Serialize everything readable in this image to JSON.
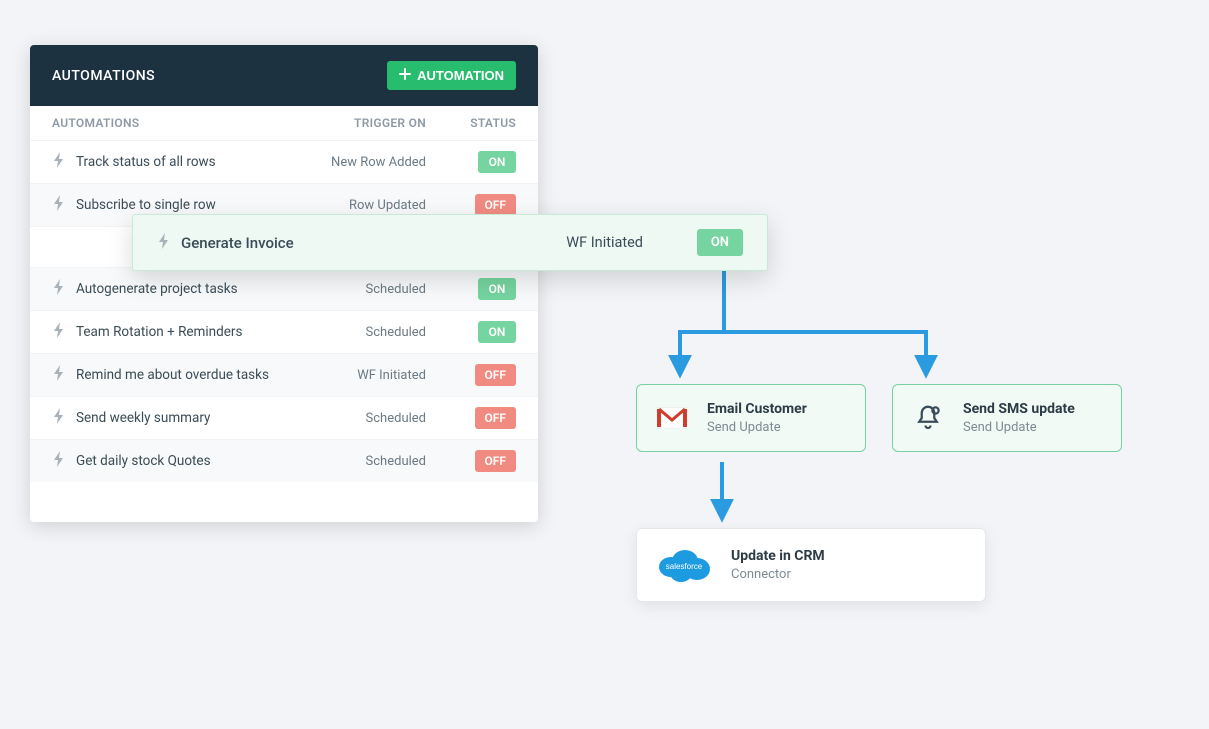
{
  "panel": {
    "title": "AUTOMATIONS",
    "addButton": "AUTOMATION",
    "columns": {
      "name": "AUTOMATIONS",
      "trigger": "TRIGGER ON",
      "status": "STATUS"
    }
  },
  "rows": [
    {
      "name": "Track status of all rows",
      "trigger": "New Row Added",
      "status": "ON"
    },
    {
      "name": "Subscribe to single row",
      "trigger": "Row Updated",
      "status": "OFF"
    },
    {
      "name": "Generate Invoice",
      "trigger": "WF Initiated",
      "status": "ON",
      "highlighted": true
    },
    {
      "name": "Autogenerate project tasks",
      "trigger": "Scheduled",
      "status": "ON"
    },
    {
      "name": "Team Rotation + Reminders",
      "trigger": "Scheduled",
      "status": "ON"
    },
    {
      "name": "Remind me about overdue tasks",
      "trigger": "WF Initiated",
      "status": "OFF"
    },
    {
      "name": "Send weekly summary",
      "trigger": "Scheduled",
      "status": "OFF"
    },
    {
      "name": "Get daily stock Quotes",
      "trigger": "Scheduled",
      "status": "OFF"
    }
  ],
  "flow": {
    "email": {
      "title": "Email Customer",
      "sub": "Send Update",
      "icon": "gmail-icon"
    },
    "sms": {
      "title": "Send SMS update",
      "sub": "Send Update",
      "icon": "bell-icon"
    },
    "crm": {
      "title": "Update in CRM",
      "sub": "Connector",
      "icon": "salesforce-icon"
    }
  },
  "colors": {
    "on": "#75d49f",
    "off": "#f18b82",
    "accent": "#27bc6e",
    "arrow": "#2a9be0"
  }
}
